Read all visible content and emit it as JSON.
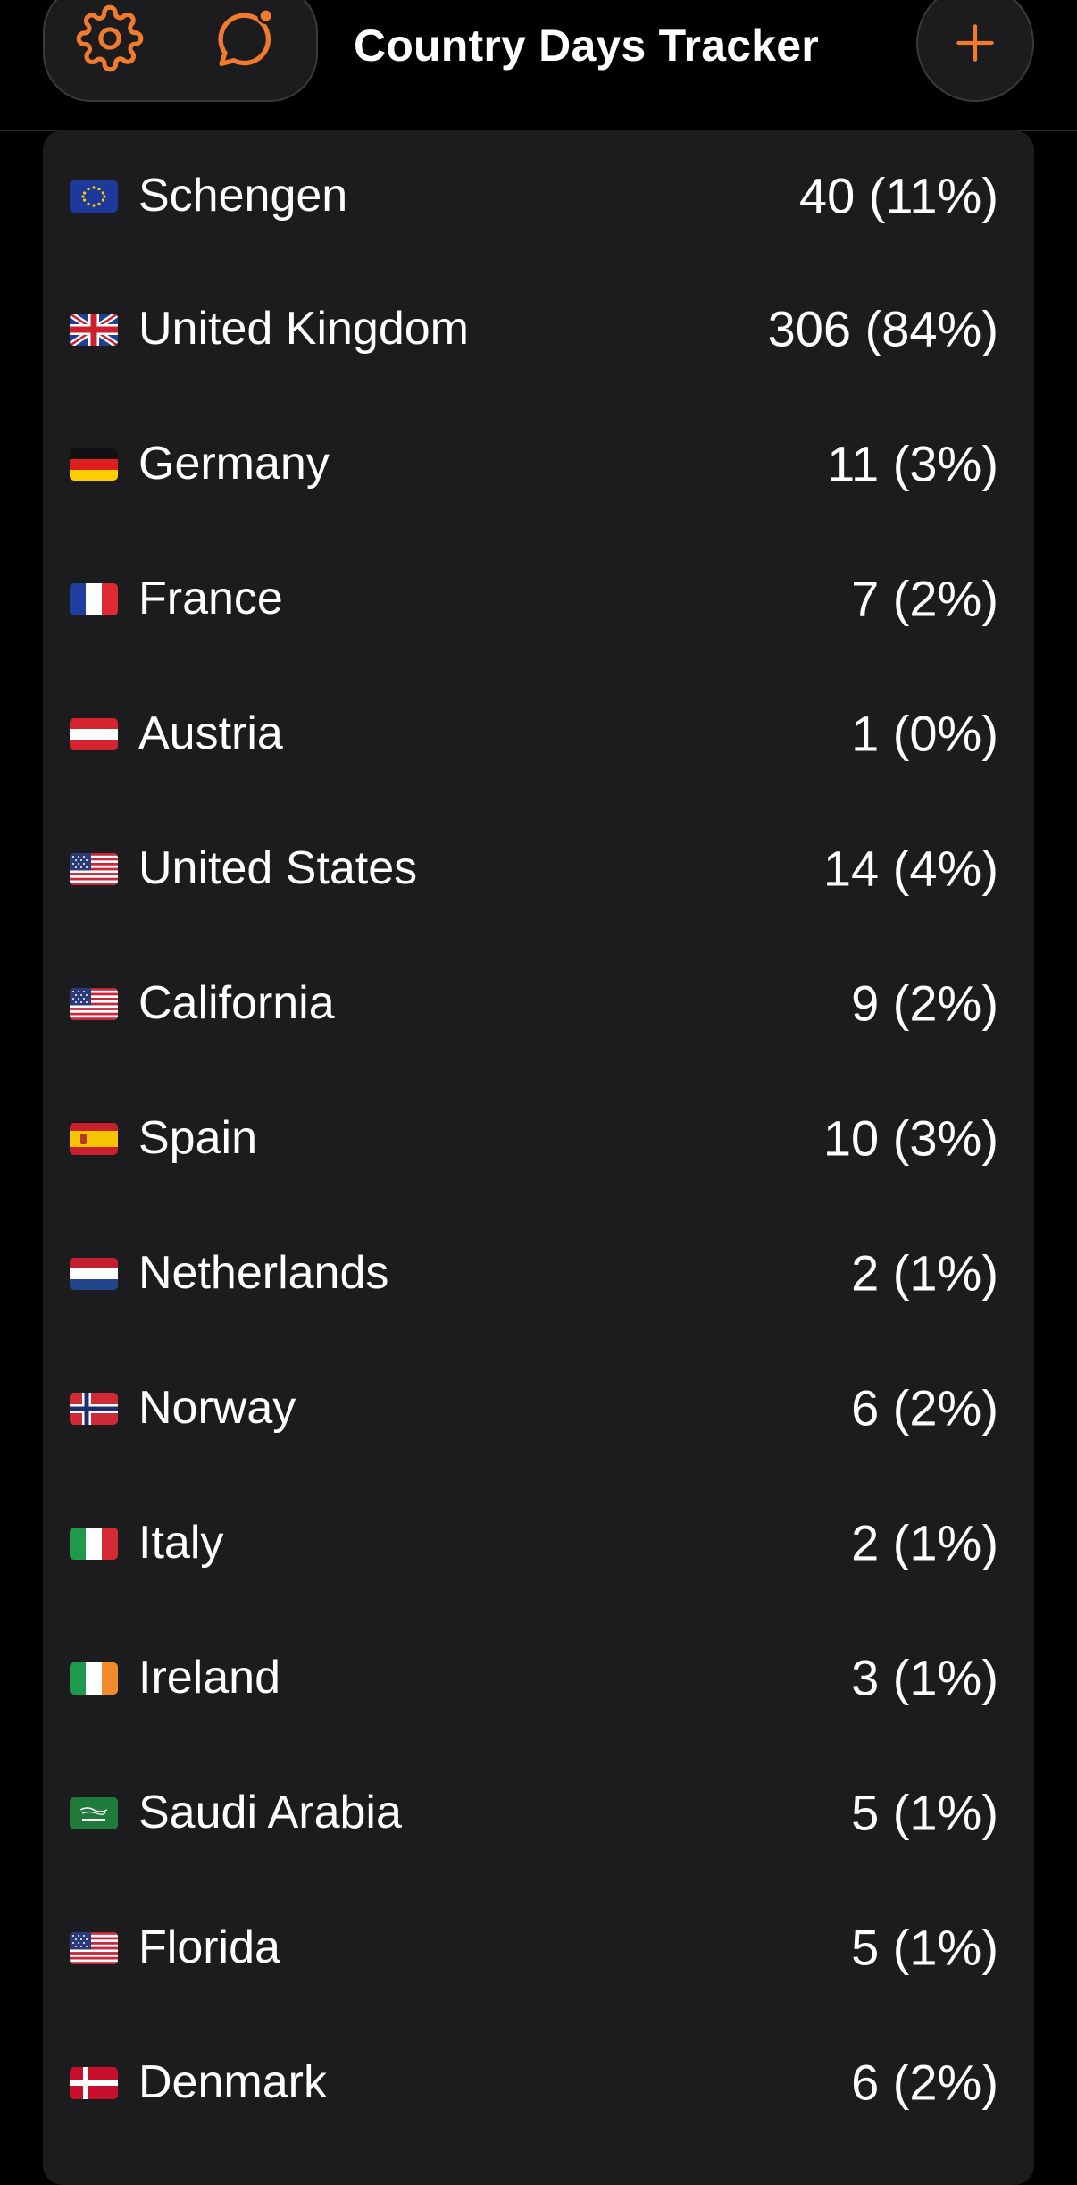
{
  "app": {
    "title": "Country Days Tracker",
    "accent_color": "#f07a2e",
    "background": "#000000",
    "card_background": "#1c1c1e"
  },
  "toolbar": {
    "settings_icon": "gear-icon",
    "feedback_icon": "chat-bubble-icon",
    "feedback_has_notification": true,
    "add_icon": "plus-icon"
  },
  "countries": [
    {
      "name": "Schengen",
      "value": "40 (11%)",
      "flag": "eu"
    },
    {
      "name": "United Kingdom",
      "value": "306 (84%)",
      "flag": "gb"
    },
    {
      "name": "Germany",
      "value": "11 (3%)",
      "flag": "de"
    },
    {
      "name": "France",
      "value": "7 (2%)",
      "flag": "fr"
    },
    {
      "name": "Austria",
      "value": "1 (0%)",
      "flag": "at"
    },
    {
      "name": "United States",
      "value": "14 (4%)",
      "flag": "us"
    },
    {
      "name": "California",
      "value": "9 (2%)",
      "flag": "us"
    },
    {
      "name": "Spain",
      "value": "10 (3%)",
      "flag": "es"
    },
    {
      "name": "Netherlands",
      "value": "2 (1%)",
      "flag": "nl"
    },
    {
      "name": "Norway",
      "value": "6 (2%)",
      "flag": "no"
    },
    {
      "name": "Italy",
      "value": "2 (1%)",
      "flag": "it"
    },
    {
      "name": "Ireland",
      "value": "3 (1%)",
      "flag": "ie"
    },
    {
      "name": "Saudi Arabia",
      "value": "5 (1%)",
      "flag": "sa"
    },
    {
      "name": "Florida",
      "value": "5 (1%)",
      "flag": "us"
    },
    {
      "name": "Denmark",
      "value": "6 (2%)",
      "flag": "dk"
    }
  ]
}
